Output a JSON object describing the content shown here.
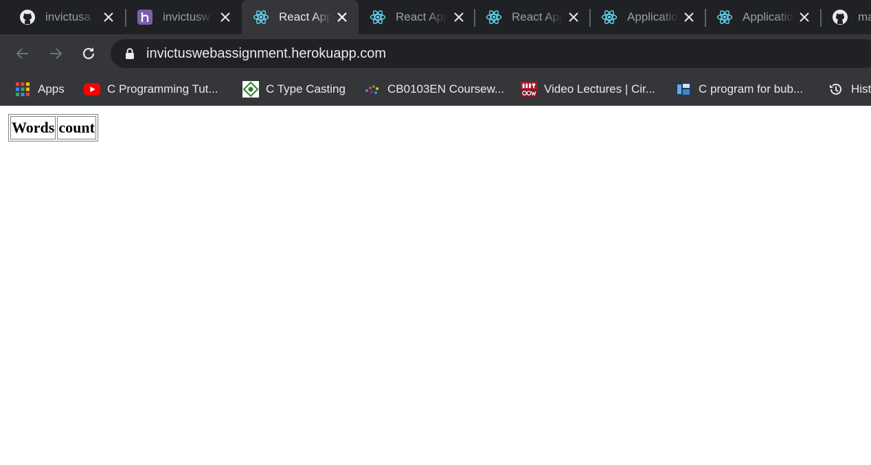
{
  "browser": {
    "tabs": [
      {
        "title": "invictusa",
        "icon": "github-icon",
        "active": false
      },
      {
        "title": "invictusw",
        "icon": "heroku-icon",
        "active": false
      },
      {
        "title": "React App",
        "icon": "react-icon",
        "active": true
      },
      {
        "title": "React App",
        "icon": "react-icon",
        "active": false
      },
      {
        "title": "React App",
        "icon": "react-icon",
        "active": false
      },
      {
        "title": "Application",
        "icon": "react-icon",
        "active": false
      },
      {
        "title": "Application",
        "icon": "react-icon",
        "active": false
      },
      {
        "title": "ma",
        "icon": "github-icon",
        "active": false
      }
    ],
    "address_bar": {
      "url": "invictuswebassignment.herokuapp.com"
    },
    "bookmarks": [
      {
        "label": "Apps",
        "icon": "apps-grid-icon"
      },
      {
        "label": "C Programming Tut...",
        "icon": "youtube-icon"
      },
      {
        "label": "C Type Casting",
        "icon": "site-badge-icon"
      },
      {
        "label": "CB0103EN Coursew...",
        "icon": "dots-logo-icon"
      },
      {
        "label": "Video Lectures | Cir...",
        "icon": "mit-ocw-icon"
      },
      {
        "label": "C program for bub...",
        "icon": "site-thumbnail-icon"
      },
      {
        "label": "History",
        "icon": "history-icon"
      }
    ],
    "colors": {
      "tabstrip": "#202124",
      "toolbar": "#35363a",
      "react": "#61dafb",
      "heroku": "#7b5fab",
      "youtube": "#ff0000",
      "mit": "#a31f34"
    }
  },
  "page": {
    "table": {
      "headers": [
        "Words",
        "count"
      ]
    }
  }
}
